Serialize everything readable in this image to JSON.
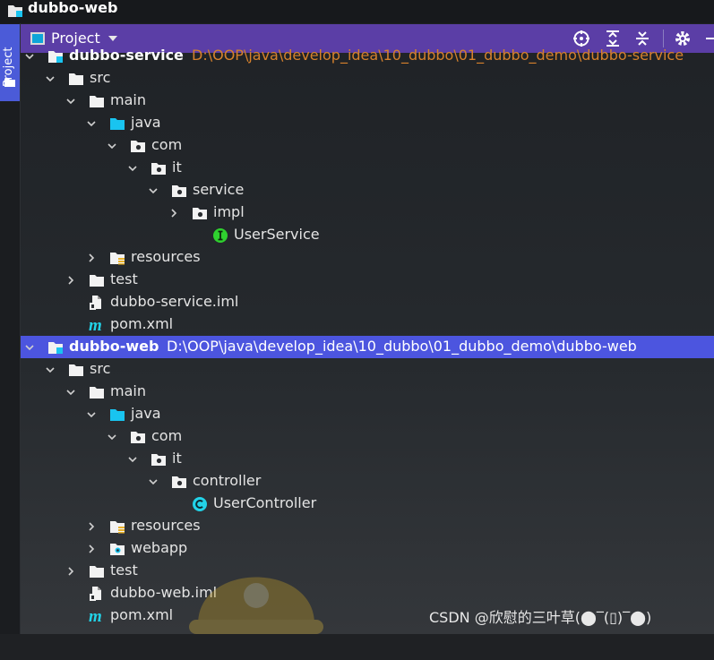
{
  "window": {
    "title": "dubbo-web"
  },
  "side_tab": {
    "label": "Project"
  },
  "panel_header": {
    "view_label": "Project",
    "buttons": [
      {
        "name": "locate-button",
        "icon": "crosshair-icon"
      },
      {
        "name": "expand-all-button",
        "icon": "expand-all-icon"
      },
      {
        "name": "collapse-all-button",
        "icon": "collapse-all-icon"
      },
      {
        "name": "settings-button",
        "icon": "gear-icon"
      },
      {
        "name": "hide-button",
        "icon": "minus-icon"
      }
    ]
  },
  "colors": {
    "header": "#5b3ea6",
    "selection": "#4c55df",
    "path": "#d6812c",
    "java_folder": "#19c4f0",
    "interface_badge": "#2fd12f",
    "class_badge": "#22d3e8"
  },
  "tree": [
    {
      "label": "dubbo-service",
      "path": "D:\\OOP\\java\\develop_idea\\10_dubbo\\01_dubbo_demo\\dubbo-service",
      "icon": "module-icon",
      "depth": 0,
      "arrow": "down",
      "module": true
    },
    {
      "label": "src",
      "icon": "folder-icon",
      "depth": 1,
      "arrow": "down"
    },
    {
      "label": "main",
      "icon": "folder-icon",
      "depth": 2,
      "arrow": "down"
    },
    {
      "label": "java",
      "icon": "source-folder-icon",
      "depth": 3,
      "arrow": "down"
    },
    {
      "label": "com",
      "icon": "package-icon",
      "depth": 4,
      "arrow": "down"
    },
    {
      "label": "it",
      "icon": "package-icon",
      "depth": 5,
      "arrow": "down"
    },
    {
      "label": "service",
      "icon": "package-icon",
      "depth": 6,
      "arrow": "down"
    },
    {
      "label": "impl",
      "icon": "package-icon",
      "depth": 7,
      "arrow": "right"
    },
    {
      "label": "UserService",
      "icon": "interface-icon",
      "depth": 8,
      "arrow": "none"
    },
    {
      "label": "resources",
      "icon": "resources-folder-icon",
      "depth": 3,
      "arrow": "right"
    },
    {
      "label": "test",
      "icon": "folder-icon",
      "depth": 2,
      "arrow": "right"
    },
    {
      "label": "dubbo-service.iml",
      "icon": "iml-file-icon",
      "depth": 2,
      "arrow": "none"
    },
    {
      "label": "pom.xml",
      "icon": "maven-icon",
      "depth": 2,
      "arrow": "none"
    },
    {
      "label": "dubbo-web",
      "path": "D:\\OOP\\java\\develop_idea\\10_dubbo\\01_dubbo_demo\\dubbo-web",
      "icon": "module-icon",
      "depth": 0,
      "arrow": "down",
      "module": true,
      "selected": true
    },
    {
      "label": "src",
      "icon": "folder-icon",
      "depth": 1,
      "arrow": "down"
    },
    {
      "label": "main",
      "icon": "folder-icon",
      "depth": 2,
      "arrow": "down"
    },
    {
      "label": "java",
      "icon": "source-folder-icon",
      "depth": 3,
      "arrow": "down"
    },
    {
      "label": "com",
      "icon": "package-icon",
      "depth": 4,
      "arrow": "down"
    },
    {
      "label": "it",
      "icon": "package-icon",
      "depth": 5,
      "arrow": "down"
    },
    {
      "label": "controller",
      "icon": "package-icon",
      "depth": 6,
      "arrow": "down"
    },
    {
      "label": "UserController",
      "icon": "class-icon",
      "depth": 7,
      "arrow": "none"
    },
    {
      "label": "resources",
      "icon": "resources-folder-icon",
      "depth": 3,
      "arrow": "right"
    },
    {
      "label": "webapp",
      "icon": "web-folder-icon",
      "depth": 3,
      "arrow": "right"
    },
    {
      "label": "test",
      "icon": "folder-icon",
      "depth": 2,
      "arrow": "right"
    },
    {
      "label": "dubbo-web.iml",
      "icon": "iml-file-icon",
      "depth": 2,
      "arrow": "none"
    },
    {
      "label": "pom.xml",
      "icon": "maven-icon",
      "depth": 2,
      "arrow": "none"
    }
  ],
  "watermark": "CSDN @欣慰的三叶草(⬤‾(▯)‾⬤)"
}
